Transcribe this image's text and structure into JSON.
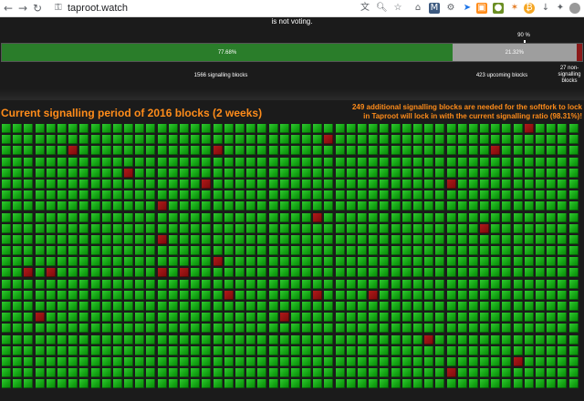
{
  "browser": {
    "url": "taproot.watch",
    "nav_back": "←",
    "nav_forward": "→",
    "nav_reload": "↻",
    "home": "⌂",
    "lock": "⚿",
    "extension_icons": [
      "translate-icon",
      "zoom-icon",
      "star-icon",
      "home-icon",
      "ext-icon",
      "ext-icon",
      "ext-icon",
      "ext-icon",
      "ext-icon",
      "ext-icon",
      "ext-icon",
      "ext-icon",
      "ext-icon",
      "puzzle-icon",
      "profile-icon"
    ]
  },
  "page": {
    "voting_note": "is not voting.",
    "progress": {
      "signalling_pct_label": "77.68%",
      "upcoming_pct_label": "21.32%",
      "signalling_fraction": 0.7768,
      "upcoming_fraction": 0.2132,
      "nonsignalling_fraction": 0.0134,
      "threshold_label": "90 %",
      "threshold_fraction": 0.9,
      "signalling_caption": "1566 signalling blocks",
      "upcoming_caption": "423 upcoming blocks",
      "nonsignalling_caption": "27 non-signalling blocks"
    },
    "period_title": "Current signalling period of 2016 blocks (2 weeks)",
    "needed_text": "249 additional signalling blocks are needed for the softfork to lock in Taproot will lock in with the current signalling ratio (98.31%)!",
    "colors": {
      "accent_orange": "#ff8c1a",
      "signalling_green": "#2a7d2a",
      "upcoming_grey": "#9e9e9e",
      "nonsignalling_red": "#8b1a1a"
    },
    "grid": {
      "columns": 52,
      "rows": 24,
      "red_blocks": [
        [
          0,
          47
        ],
        [
          1,
          29
        ],
        [
          2,
          6
        ],
        [
          2,
          19
        ],
        [
          2,
          44
        ],
        [
          4,
          11
        ],
        [
          5,
          18
        ],
        [
          5,
          40
        ],
        [
          7,
          14
        ],
        [
          8,
          28
        ],
        [
          9,
          43
        ],
        [
          10,
          14
        ],
        [
          12,
          19
        ],
        [
          13,
          2
        ],
        [
          13,
          4
        ],
        [
          13,
          14
        ],
        [
          13,
          16
        ],
        [
          15,
          20
        ],
        [
          15,
          28
        ],
        [
          15,
          33
        ],
        [
          17,
          3
        ],
        [
          17,
          25
        ],
        [
          19,
          38
        ],
        [
          21,
          46
        ],
        [
          22,
          40
        ]
      ]
    }
  }
}
